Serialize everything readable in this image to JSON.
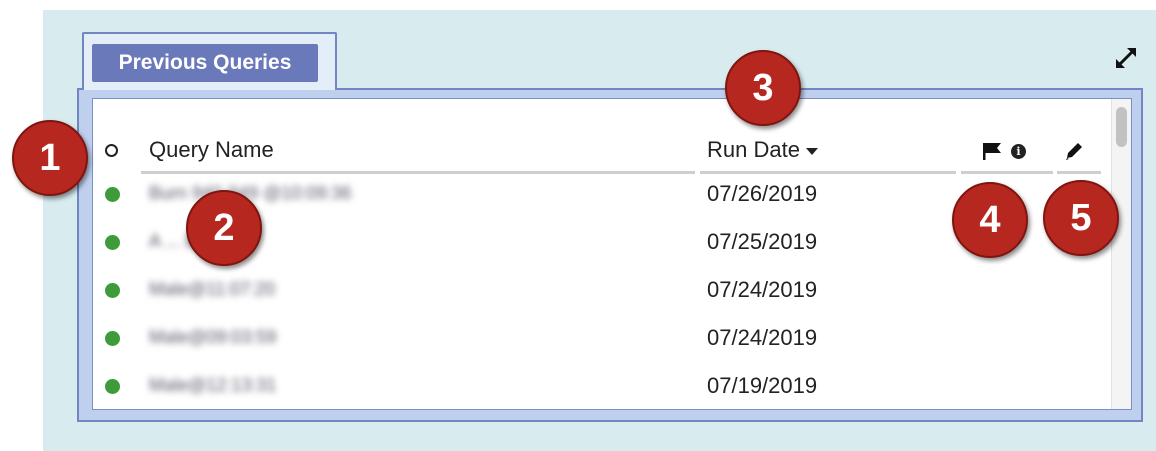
{
  "panel": {
    "tab_label": "Previous Queries"
  },
  "table": {
    "columns": {
      "query_name": "Query Name",
      "run_date": "Run Date"
    },
    "rows": [
      {
        "name": "Burn 940-949 @10:09:36",
        "date": "07/26/2019",
        "status": "green"
      },
      {
        "name": "A ... Bill",
        "date": "07/25/2019",
        "status": "green"
      },
      {
        "name": "Male@11:07:20",
        "date": "07/24/2019",
        "status": "green"
      },
      {
        "name": "Male@09:03:59",
        "date": "07/24/2019",
        "status": "green"
      },
      {
        "name": "Male@12:13:31",
        "date": "07/19/2019",
        "status": "green"
      }
    ]
  },
  "callouts": [
    "1",
    "2",
    "3",
    "4",
    "5"
  ],
  "icons": [
    "expand-icon",
    "flag-icon",
    "info-icon",
    "pencil-icon"
  ],
  "colors": {
    "tab": "#6979b9",
    "frame": "#bfd0ef",
    "status_green": "#3e9b3a",
    "badge": "#b5271f"
  }
}
